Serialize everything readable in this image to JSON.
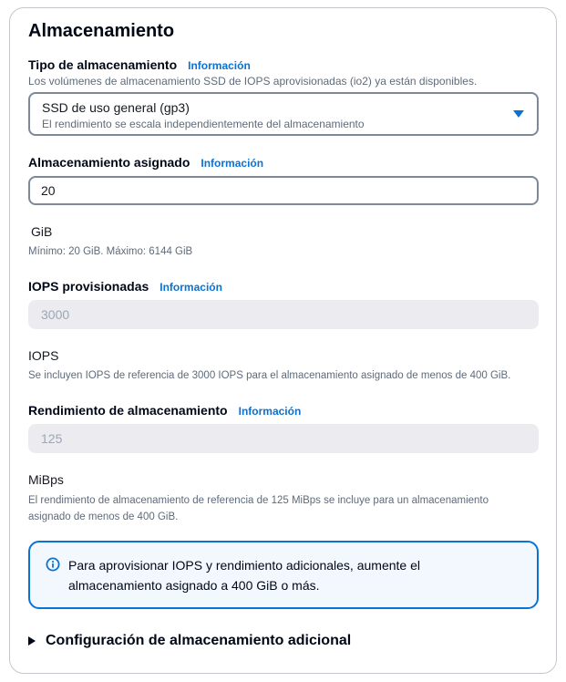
{
  "section": {
    "title": "Almacenamiento"
  },
  "info_link": "Información",
  "storage_type": {
    "label": "Tipo de almacenamiento",
    "description": "Los volúmenes de almacenamiento SSD de IOPS aprovisionadas (io2) ya están disponibles.",
    "selected": "SSD de uso general (gp3)",
    "selected_description": "El rendimiento se escala independientemente del almacenamiento"
  },
  "allocated_storage": {
    "label": "Almacenamiento asignado",
    "value": "20",
    "unit": "GiB",
    "constraint": "Mínimo: 20 GiB. Máximo: 6144 GiB"
  },
  "provisioned_iops": {
    "label": "IOPS provisionadas",
    "value": "3000",
    "unit": "IOPS",
    "description": "Se incluyen IOPS de referencia de 3000 IOPS para el almacenamiento asignado de menos de 400 GiB."
  },
  "storage_throughput": {
    "label": "Rendimiento de almacenamiento",
    "value": "125",
    "unit": "MiBps",
    "description_line1": "El rendimiento de almacenamiento de referencia de 125 MiBps se incluye para un almacenamiento",
    "description_line2": "asignado de menos de 400 GiB."
  },
  "alert": {
    "line1": "Para aprovisionar IOPS y rendimiento adicionales, aumente el",
    "line2": "almacenamiento asignado a 400 GiB o más."
  },
  "additional_config": {
    "label": "Configuración de almacenamiento adicional"
  },
  "colors": {
    "accent": "#0972d3",
    "disabled_bg": "#ebebf0",
    "border": "#7d8998"
  }
}
